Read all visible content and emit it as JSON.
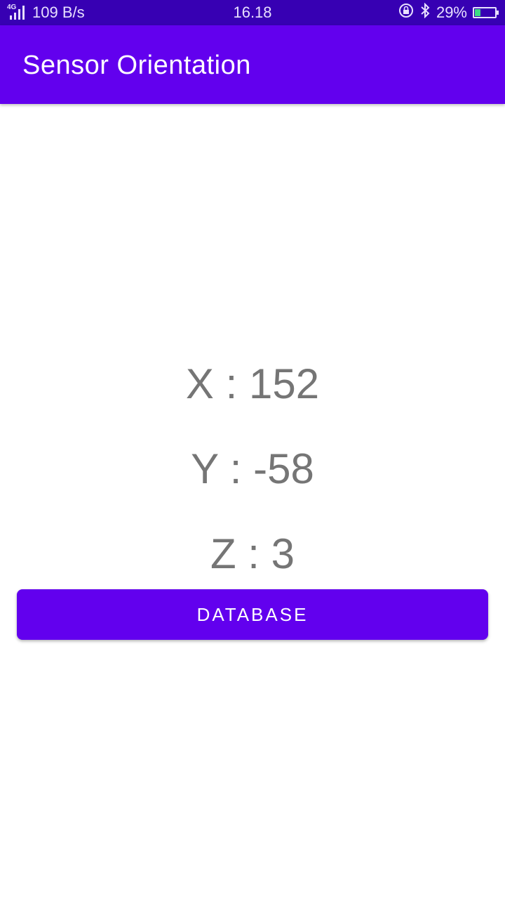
{
  "status_bar": {
    "network_type": "4G",
    "net_speed": "109 B/s",
    "time": "16.18",
    "battery_percent": "29%",
    "battery_level": 0.29,
    "icons": [
      "signal-icon",
      "rotation-lock-icon",
      "bluetooth-icon",
      "battery-charging-icon"
    ]
  },
  "app_bar": {
    "title": "Sensor Orientation",
    "color": "#6200ee"
  },
  "readings": {
    "x": "X : 152",
    "y": "Y : -58",
    "z": "Z : 3"
  },
  "actions": {
    "database_label": "DATABASE"
  }
}
